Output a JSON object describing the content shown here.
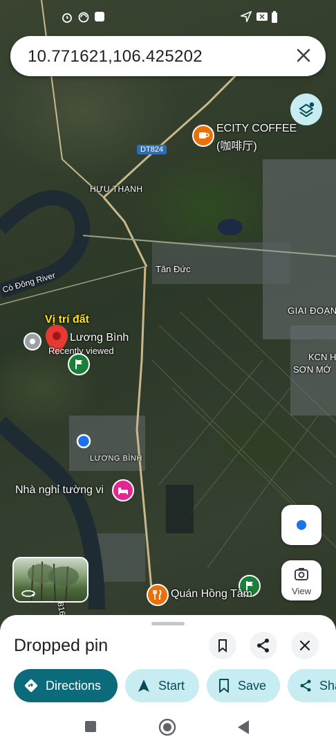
{
  "status_bar": {
    "icons_left": [
      "alarm-icon",
      "swirl-icon",
      "square-icon"
    ],
    "icons_right": [
      "location-icon",
      "battery-x-icon",
      "battery-icon"
    ]
  },
  "search": {
    "value": "10.771621,106.425202"
  },
  "map_labels": {
    "poi_coffee": "ECITY COFFEE",
    "poi_coffee_sub": "(咖啡厅)",
    "road_dt824": "DT824",
    "huu_thanh": "HỰU THẠNH",
    "tan_duc": "Tân Đức",
    "co_dong_river": "Cò Đông River",
    "vi_tri_dat": "Vị trí đất",
    "luong_binh_pin": "Lương Bình",
    "recently_viewed": "Recently viewed",
    "giai_doan": "GIAI ĐOẠN",
    "kcn_h": "KCN H",
    "son_mo": "SƠN MỚ",
    "luong_binh_area": "LƯƠNG BÌNH",
    "nha_nghi": "Nhà nghỉ tường vi",
    "quan_hong_tam": "Quán Hồng Tâm",
    "road_816": "816"
  },
  "street_view": {
    "icon": "360-icon"
  },
  "view_button": {
    "label": "View"
  },
  "sheet": {
    "title": "Dropped pin",
    "chips": [
      {
        "label": "Directions"
      },
      {
        "label": "Start"
      },
      {
        "label": "Save"
      },
      {
        "label": "Sha"
      }
    ]
  },
  "colors": {
    "accent": "#0b6b7a",
    "chip_bg": "#c7ecf2",
    "pin": "#e53935"
  }
}
